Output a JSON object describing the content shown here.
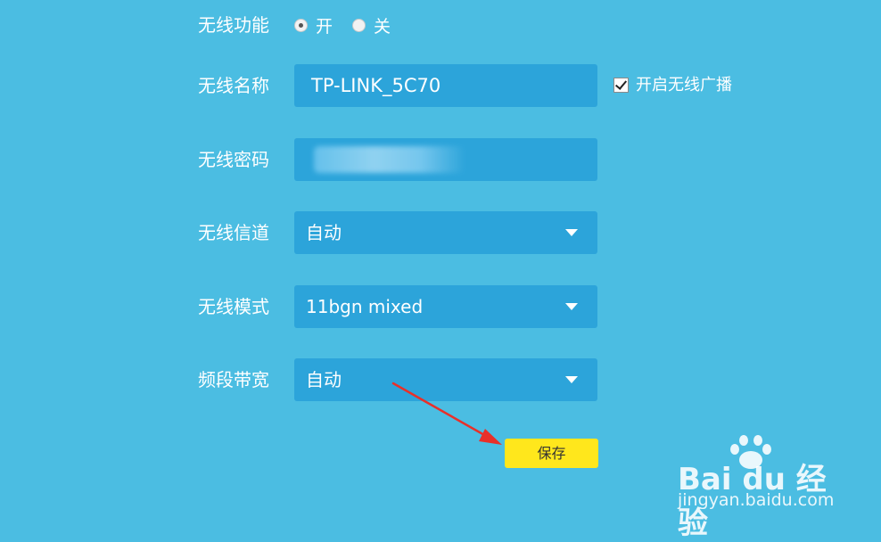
{
  "form": {
    "wireless_function": {
      "label": "无线功能",
      "options": [
        "开",
        "关"
      ],
      "selected": "开"
    },
    "ssid": {
      "label": "无线名称",
      "value": "TP-LINK_5C70",
      "broadcast_label": "开启无线广播",
      "broadcast_checked": true
    },
    "password": {
      "label": "无线密码"
    },
    "channel": {
      "label": "无线信道",
      "value": "自动"
    },
    "mode": {
      "label": "无线模式",
      "value": "11bgn mixed"
    },
    "bandwidth": {
      "label": "频段带宽",
      "value": "自动"
    },
    "save_label": "保存"
  },
  "annotation": {
    "arrow_color": "#e8302a"
  },
  "watermark": {
    "logo_text": "Bai du 经验",
    "url": "jingyan.baidu.com"
  },
  "colors": {
    "background": "#4bbde2",
    "field": "#2ca4da",
    "save_button": "#ffe71c"
  }
}
